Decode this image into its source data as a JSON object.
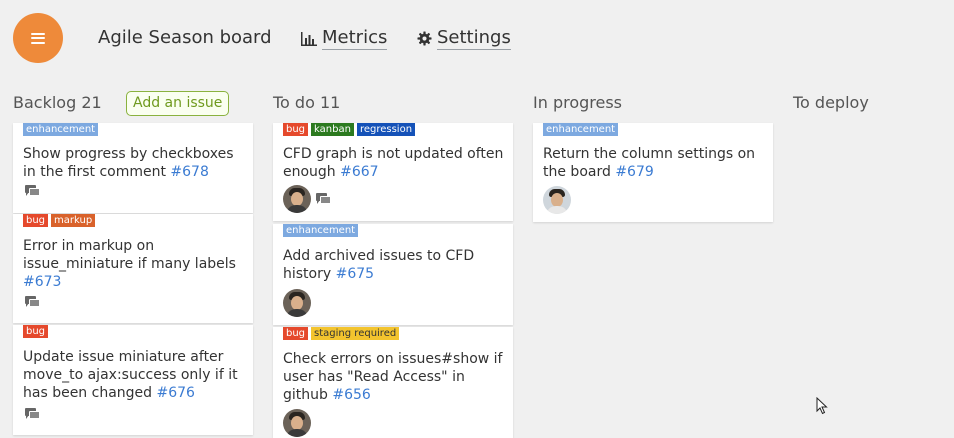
{
  "header": {
    "board_title": "Agile Season board",
    "metrics_label": "Metrics",
    "settings_label": "Settings",
    "accent_color": "#ee8a3a"
  },
  "columns": [
    {
      "title": "Backlog 21",
      "action": "Add an issue"
    },
    {
      "title": "To do 11"
    },
    {
      "title": "In progress"
    },
    {
      "title": "To deploy"
    }
  ],
  "cards": {
    "backlog": [
      {
        "labels": [
          "enhancement"
        ],
        "text": "Show progress by checkboxes in the first comment",
        "number": "#678",
        "comments": true
      },
      {
        "labels": [
          "bug",
          "markup"
        ],
        "text": "Error in markup on issue_miniature if many labels",
        "number": "#673",
        "comments": true
      },
      {
        "labels": [
          "bug"
        ],
        "text": "Update issue miniature after move_to ajax:success only if it has been changed",
        "number": "#676",
        "comments": true
      }
    ],
    "todo": [
      {
        "labels": [
          "bug",
          "kanban",
          "regression"
        ],
        "text": "CFD graph is not updated often enough",
        "number": "#667",
        "comments": true,
        "avatar": "user-avatar"
      },
      {
        "labels": [
          "enhancement"
        ],
        "text": "Add archived issues to CFD history",
        "number": "#675",
        "avatar": "user-avatar"
      },
      {
        "labels": [
          "bug",
          "staging required"
        ],
        "text": "Check errors on issues#show if user has \"Read Access\" in github",
        "number": "#656",
        "avatar": "user-avatar"
      }
    ],
    "in_progress": [
      {
        "labels": [
          "enhancement"
        ],
        "text": "Return the column settings on the board",
        "number": "#679",
        "avatar": "user-avatar"
      }
    ]
  },
  "label_colors": {
    "enhancement": "#7da9e0",
    "bug": "#e5492c",
    "markup": "#d9622b",
    "kanban": "#2c7a1f",
    "regression": "#1552b8",
    "staging required": "#f3c42e"
  },
  "link_color": "#3b7bd2"
}
